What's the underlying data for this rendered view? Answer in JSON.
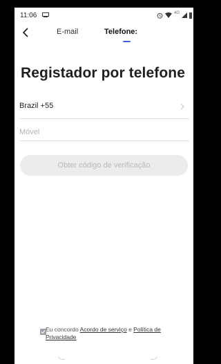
{
  "status_bar": {
    "time": "11:06",
    "network_label": "4G"
  },
  "nav": {
    "email_tab": "E-mail",
    "phone_tab": "Telefone:",
    "active_tab": "phone",
    "accent_color": "#3c5fe0"
  },
  "title": "Registador por telefone",
  "country": {
    "label": "Brazil +55"
  },
  "phone": {
    "placeholder": "Móvel",
    "value": ""
  },
  "code_button": {
    "label": "Obter código de verificação",
    "enabled": false
  },
  "agreement": {
    "checked": true,
    "prefix": "Eu concordo",
    "service_link": "Acordo de serviço",
    "conjunction": "e",
    "privacy_link_line1": "Política de",
    "privacy_link_line2": "Privacidade"
  }
}
